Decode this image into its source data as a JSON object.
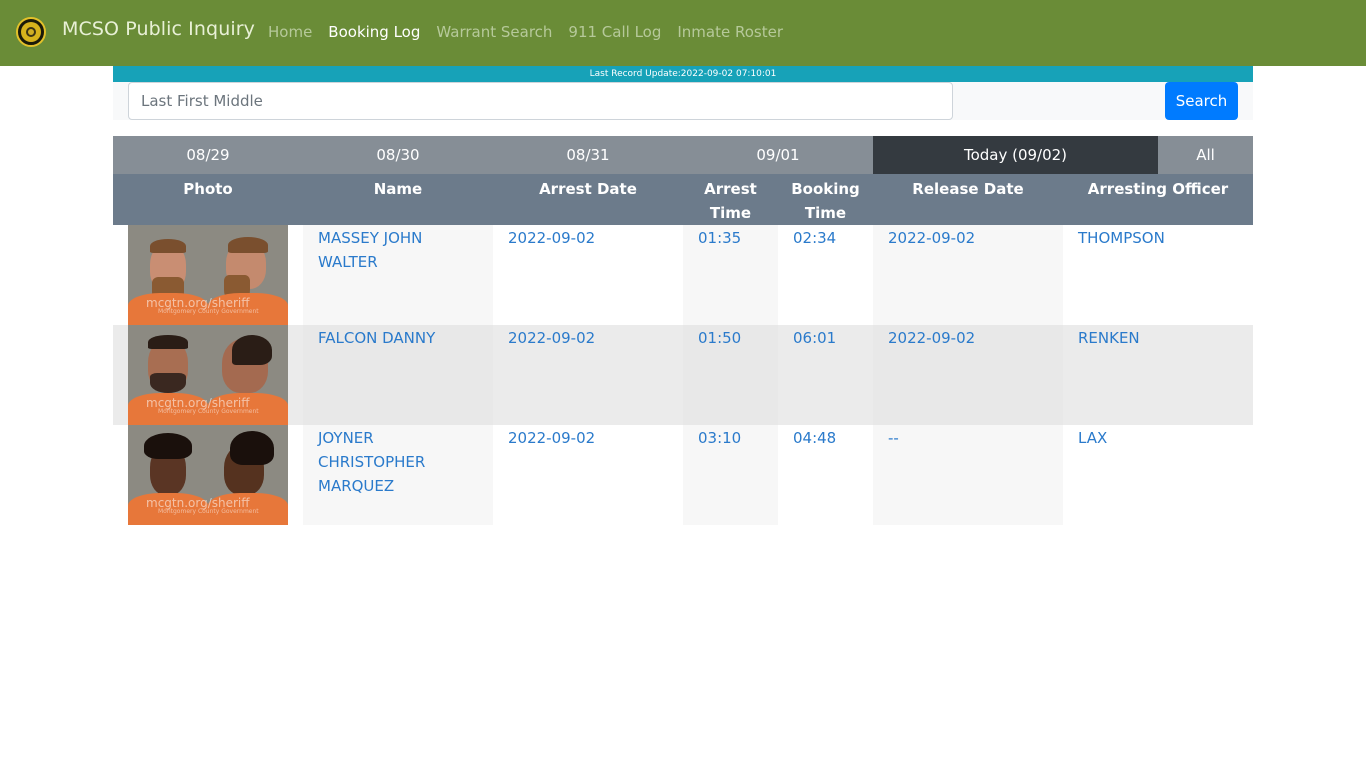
{
  "navbar": {
    "brand": "MCSO Public Inquiry",
    "logo": "sheriff-badge-icon",
    "links": [
      {
        "label": "Home",
        "active": false
      },
      {
        "label": "Booking Log",
        "active": true
      },
      {
        "label": "Warrant Search",
        "active": false
      },
      {
        "label": "911 Call Log",
        "active": false
      },
      {
        "label": "Inmate Roster",
        "active": false
      }
    ],
    "color": "#6a8c37"
  },
  "update_bar": {
    "text": "Last Record Update:2022-09-02 07:10:01",
    "color": "#17a2b8"
  },
  "search": {
    "value": "",
    "placeholder": "Last First Middle",
    "button_label": "Search",
    "button_color": "#007bff"
  },
  "date_tabs": [
    {
      "label": "08/29",
      "active": false
    },
    {
      "label": "08/30",
      "active": false
    },
    {
      "label": "08/31",
      "active": false
    },
    {
      "label": "09/01",
      "active": false
    },
    {
      "label": "Today (09/02)",
      "active": true
    },
    {
      "label": "All",
      "active": false
    }
  ],
  "table": {
    "headers": {
      "photo": "Photo",
      "name": "Name",
      "arrest_date": "Arrest Date",
      "arrest_time": "Arrest Time",
      "booking_time": "Booking Time",
      "release_date": "Release Date",
      "arresting_officer": "Arresting Officer"
    },
    "rows": [
      {
        "photo_watermark": "mcgtn.org/sheriff",
        "photo_caption": "Montgomery County Government",
        "name": "MASSEY JOHN WALTER",
        "arrest_date": "2022-09-02",
        "arrest_time": "01:35",
        "booking_time": "02:34",
        "release_date": "2022-09-02",
        "arresting_officer": "THOMPSON"
      },
      {
        "photo_watermark": "mcgtn.org/sheriff",
        "photo_caption": "Montgomery County Government",
        "name": "FALCON DANNY",
        "arrest_date": "2022-09-02",
        "arrest_time": "01:50",
        "booking_time": "06:01",
        "release_date": "2022-09-02",
        "arresting_officer": "RENKEN"
      },
      {
        "photo_watermark": "mcgtn.org/sheriff",
        "photo_caption": "Montgomery County Government",
        "name": "JOYNER CHRISTOPHER MARQUEZ",
        "arrest_date": "2022-09-02",
        "arrest_time": "03:10",
        "booking_time": "04:48",
        "release_date": "--",
        "arresting_officer": "LAX"
      }
    ]
  }
}
